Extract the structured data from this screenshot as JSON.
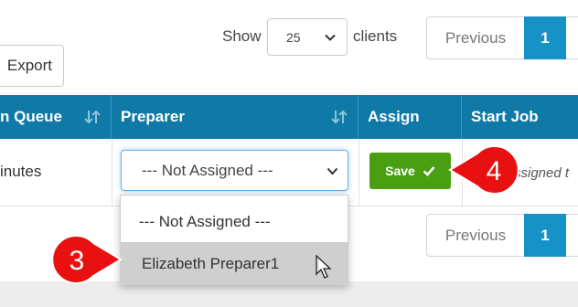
{
  "toolbar": {
    "export_label": "Export",
    "show_label": "Show",
    "page_size_value": "25",
    "clients_label": "clients"
  },
  "pagination": {
    "previous_label": "Previous",
    "current_page": "1"
  },
  "table": {
    "headers": {
      "queue": "n Queue",
      "preparer": "Preparer",
      "assign": "Assign",
      "start_job": "Start Job"
    },
    "row": {
      "queue_time": "inutes",
      "preparer_selected": "--- Not Assigned ---",
      "save_label": "Save",
      "start_job_text": "ssigned t"
    }
  },
  "dropdown": {
    "options": [
      "--- Not Assigned ---",
      "Elizabeth Preparer1"
    ],
    "highlighted_index": 1
  },
  "callouts": {
    "step_3": "3",
    "step_4": "4",
    "color": "#e81010"
  },
  "colors": {
    "header_bg": "#0f7aa8",
    "active_page": "#1792c7",
    "save_button": "#4a9e12"
  },
  "icons": [
    "sort-icon",
    "chevron-down-icon",
    "checkmark-icon",
    "mouse-pointer-icon"
  ]
}
